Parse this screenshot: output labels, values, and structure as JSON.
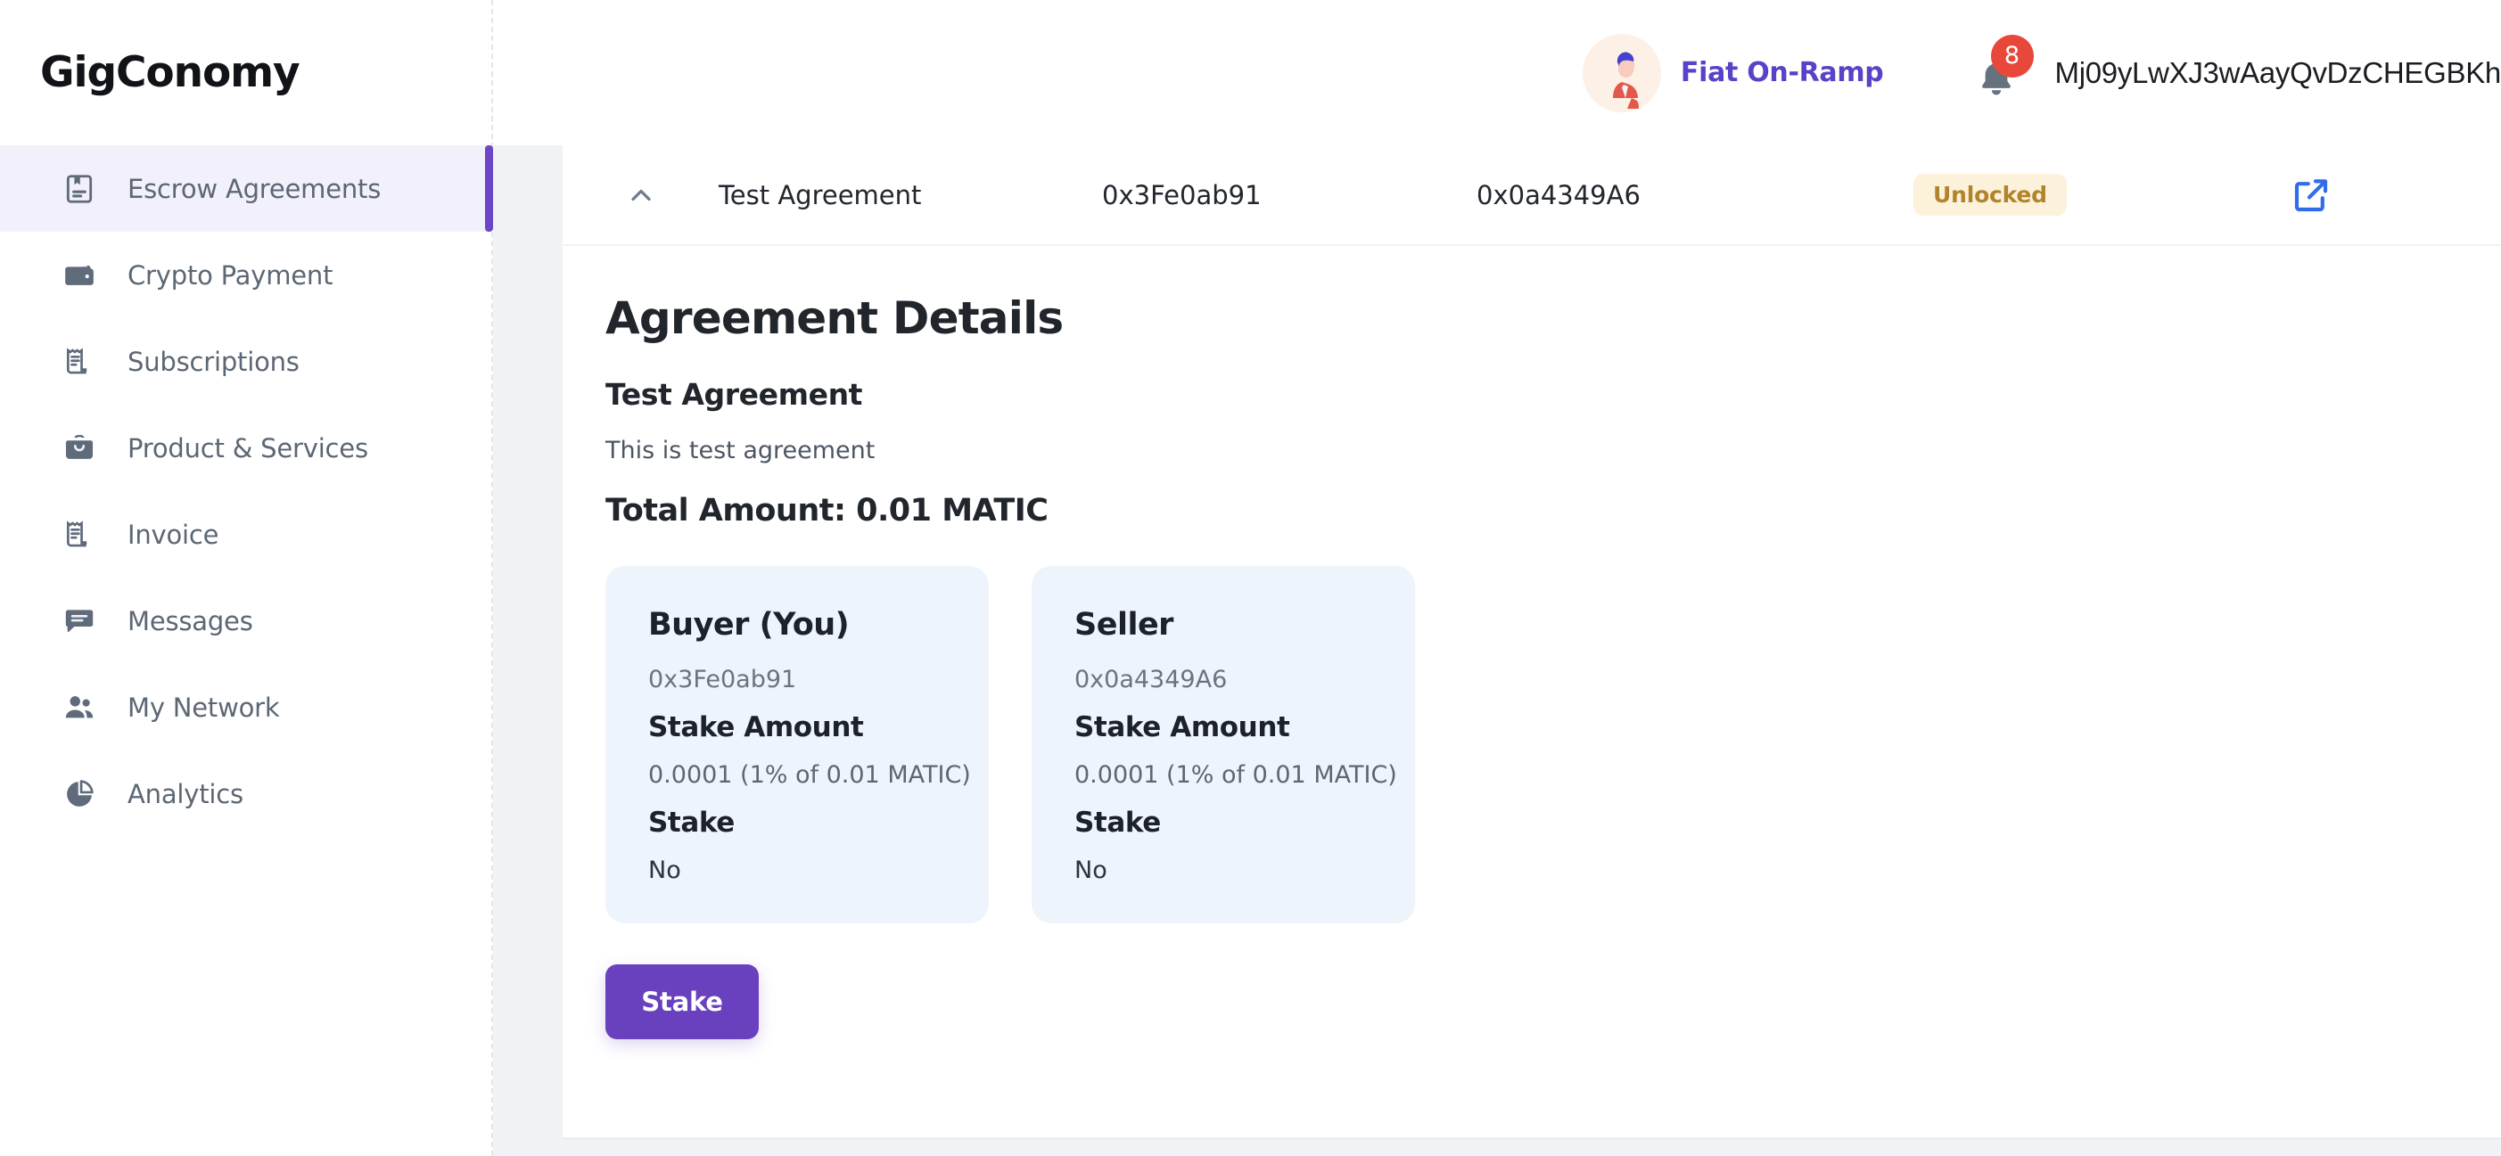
{
  "brand": {
    "name": "GigConomy"
  },
  "sidebar": {
    "items": [
      {
        "label": "Escrow Agreements",
        "icon": "book-agreement-icon",
        "active": true
      },
      {
        "label": "Crypto Payment",
        "icon": "wallet-icon",
        "active": false
      },
      {
        "label": "Subscriptions",
        "icon": "receipt-icon",
        "active": false
      },
      {
        "label": "Product & Services",
        "icon": "shopping-bag-icon",
        "active": false
      },
      {
        "label": "Invoice",
        "icon": "receipt-icon",
        "active": false
      },
      {
        "label": "Messages",
        "icon": "chat-bubble-icon",
        "active": false
      },
      {
        "label": "My Network",
        "icon": "people-icon",
        "active": false
      },
      {
        "label": "Analytics",
        "icon": "pie-chart-icon",
        "active": false
      }
    ]
  },
  "header": {
    "avatar_icon": "user-avatar-illustration",
    "fiat_label": "Fiat On-Ramp",
    "bell_icon": "notification-bell-icon",
    "notification_count": "8",
    "wallet_address": "Mj09yLwXJ3wAayQvDzCHEGBKh"
  },
  "agreement_row": {
    "chevron_icon": "chevron-up-icon",
    "title": "Test Agreement",
    "buyer_address": "0x3Fe0ab91",
    "seller_address": "0x0a4349A6",
    "status": "Unlocked",
    "external_link_icon": "external-link-icon"
  },
  "details": {
    "heading": "Agreement Details",
    "name": "Test Agreement",
    "description": "This is test agreement",
    "total": "Total Amount: 0.01 MATIC",
    "parties": [
      {
        "role": "Buyer (You)",
        "address": "0x3Fe0ab91",
        "stake_amount_label": "Stake Amount",
        "stake_amount_value": "0.0001 (1% of 0.01 MATIC)",
        "stake_label": "Stake",
        "stake_value": "No"
      },
      {
        "role": "Seller",
        "address": "0x0a4349A6",
        "stake_amount_label": "Stake Amount",
        "stake_amount_value": "0.0001 (1% of 0.01 MATIC)",
        "stake_label": "Stake",
        "stake_value": "No"
      }
    ],
    "stake_button": "Stake"
  },
  "colors": {
    "accent_purple": "#6941bf",
    "active_nav_bg": "#f2f0fb",
    "active_nav_bar": "#6d46c8",
    "fiat_link": "#5842c8",
    "badge_bg": "#fcf1da",
    "badge_text": "#b1842b",
    "notification_red": "#e8483a",
    "external_link_blue": "#2f6ee8",
    "party_card_bg": "#eef4fc",
    "page_bg": "#f1f2f6"
  }
}
